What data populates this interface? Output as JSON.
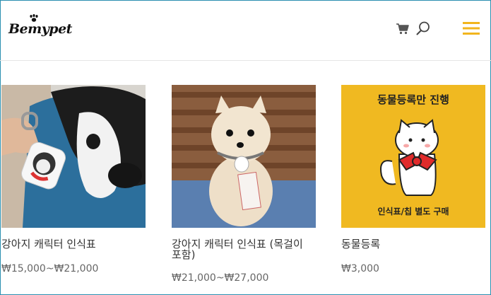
{
  "header": {
    "logo_text": "Bemypet"
  },
  "colors": {
    "accent": "#f2b51e",
    "frame": "#2a8fb0"
  },
  "icons": [
    "paw-icon",
    "cart-icon",
    "search-icon",
    "hamburger-menu-icon"
  ],
  "products": [
    {
      "title": "강아지 캐릭터 인식표",
      "price": "₩15,000~₩21,000"
    },
    {
      "title": "강아지 캐릭터 인식표 (목걸이 포함)",
      "price": "₩21,000~₩27,000"
    },
    {
      "title": "동물등록",
      "price": "₩3,000",
      "image_heading": "동물등록만 진행",
      "image_caption": "인식표/칩 별도 구매"
    }
  ]
}
